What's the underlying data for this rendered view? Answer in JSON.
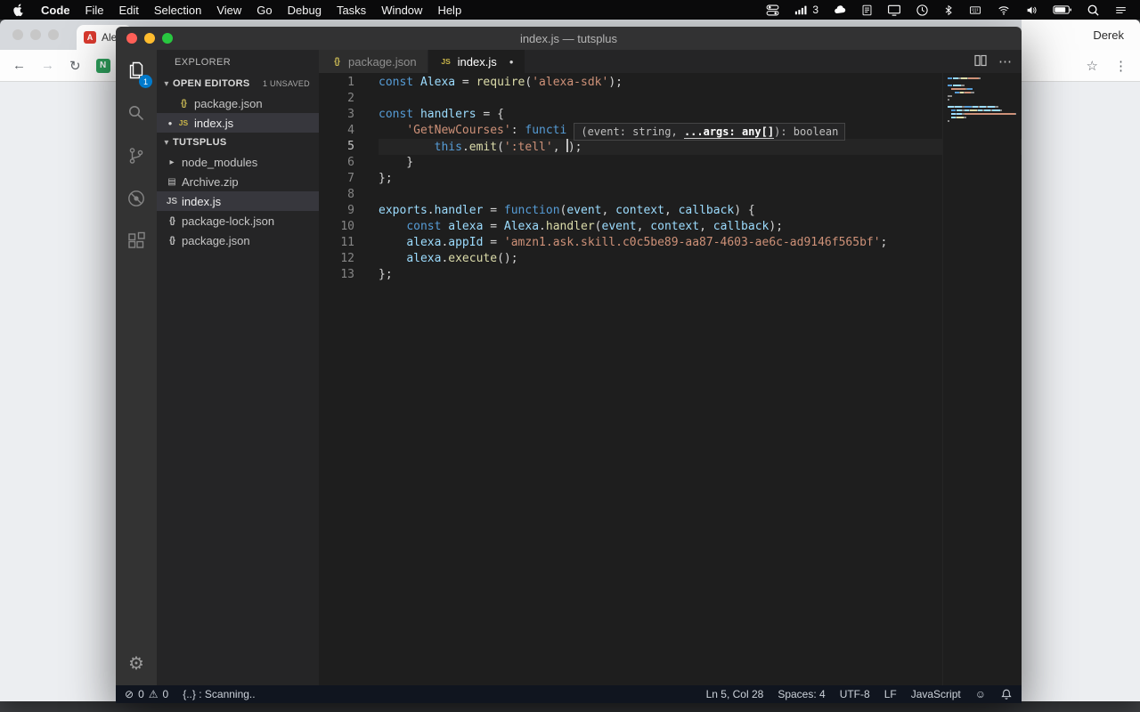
{
  "menubar": {
    "app_name": "Code",
    "items": [
      "File",
      "Edit",
      "Selection",
      "View",
      "Go",
      "Debug",
      "Tasks",
      "Window",
      "Help"
    ],
    "status": {
      "icons": [
        "control-center",
        "cellular",
        "cloud",
        "document",
        "display",
        "clock",
        "bluetooth",
        "keyboard",
        "wifi",
        "volume",
        "battery",
        "spotlight",
        "menu"
      ],
      "cellular_label": "3"
    }
  },
  "browser": {
    "tab_label": "Ale",
    "profile_name": "Derek",
    "site_badge": "N"
  },
  "vscode": {
    "title": "index.js — tutsplus",
    "activity_bar": {
      "items": [
        {
          "icon": "explorer",
          "badge": "1",
          "active": true
        },
        {
          "icon": "search",
          "active": false
        },
        {
          "icon": "source-control",
          "active": false
        },
        {
          "icon": "debug",
          "active": false
        },
        {
          "icon": "extensions",
          "active": false
        }
      ]
    },
    "sidebar": {
      "title": "EXPLORER",
      "open_editors_label": "OPEN EDITORS",
      "open_editors_badge": "1 UNSAVED",
      "open_editors": [
        {
          "icon": "json",
          "name": "package.json",
          "modified": false,
          "active": false
        },
        {
          "icon": "js",
          "name": "index.js",
          "modified": true,
          "active": true
        }
      ],
      "folder_label": "TUTSPLUS",
      "files": [
        {
          "icon": "folder",
          "name": "node_modules",
          "chevron": true,
          "selected": false
        },
        {
          "icon": "zip",
          "name": "Archive.zip",
          "chevron": false,
          "selected": false
        },
        {
          "icon": "js",
          "name": "index.js",
          "chevron": false,
          "selected": true
        },
        {
          "icon": "json",
          "name": "package-lock.json",
          "chevron": false,
          "selected": false
        },
        {
          "icon": "json",
          "name": "package.json",
          "chevron": false,
          "selected": false
        }
      ]
    },
    "tabs": [
      {
        "icon": "json",
        "label": "package.json",
        "active": false,
        "modified": false
      },
      {
        "icon": "js",
        "label": "index.js",
        "active": true,
        "modified": true
      }
    ],
    "editor": {
      "param_hint": {
        "pre": "(event: string, ",
        "active": "...args: any[]",
        "post": "): boolean"
      },
      "lines": [
        {
          "tokens": [
            [
              "kw",
              "const"
            ],
            [
              "pl",
              " "
            ],
            [
              "vr",
              "Alexa"
            ],
            [
              "pl",
              " = "
            ],
            [
              "fn",
              "require"
            ],
            [
              "pl",
              "("
            ],
            [
              "st",
              "'alexa-sdk'"
            ],
            [
              "pl",
              ");"
            ]
          ]
        },
        {
          "tokens": []
        },
        {
          "tokens": [
            [
              "kw",
              "const"
            ],
            [
              "pl",
              " "
            ],
            [
              "vr",
              "handlers"
            ],
            [
              "pl",
              " = {"
            ]
          ]
        },
        {
          "tokens": [
            [
              "pl",
              "    "
            ],
            [
              "st",
              "'GetNewCourses'"
            ],
            [
              "pl",
              ": "
            ],
            [
              "kw",
              "functi"
            ]
          ],
          "hint": true
        },
        {
          "tokens": [
            [
              "pl",
              "        "
            ],
            [
              "kw",
              "this"
            ],
            [
              "pl",
              "."
            ],
            [
              "fn",
              "emit"
            ],
            [
              "pl",
              "("
            ],
            [
              "st",
              "':tell'"
            ],
            [
              "pl",
              ", "
            ],
            [
              "cursor",
              ""
            ],
            [
              "pl",
              ");"
            ]
          ],
          "current": true
        },
        {
          "tokens": [
            [
              "pl",
              "    }"
            ]
          ]
        },
        {
          "tokens": [
            [
              "pl",
              "};"
            ]
          ]
        },
        {
          "tokens": []
        },
        {
          "tokens": [
            [
              "vr",
              "exports"
            ],
            [
              "pl",
              "."
            ],
            [
              "vr",
              "handler"
            ],
            [
              "pl",
              " = "
            ],
            [
              "kw",
              "function"
            ],
            [
              "pl",
              "("
            ],
            [
              "vr",
              "event"
            ],
            [
              "pl",
              ", "
            ],
            [
              "vr",
              "context"
            ],
            [
              "pl",
              ", "
            ],
            [
              "vr",
              "callback"
            ],
            [
              "pl",
              ") {"
            ]
          ]
        },
        {
          "tokens": [
            [
              "pl",
              "    "
            ],
            [
              "kw",
              "const"
            ],
            [
              "pl",
              " "
            ],
            [
              "vr",
              "alexa"
            ],
            [
              "pl",
              " = "
            ],
            [
              "vr",
              "Alexa"
            ],
            [
              "pl",
              "."
            ],
            [
              "fn",
              "handler"
            ],
            [
              "pl",
              "("
            ],
            [
              "vr",
              "event"
            ],
            [
              "pl",
              ", "
            ],
            [
              "vr",
              "context"
            ],
            [
              "pl",
              ", "
            ],
            [
              "vr",
              "callback"
            ],
            [
              "pl",
              ");"
            ]
          ]
        },
        {
          "tokens": [
            [
              "pl",
              "    "
            ],
            [
              "vr",
              "alexa"
            ],
            [
              "pl",
              "."
            ],
            [
              "vr",
              "appId"
            ],
            [
              "pl",
              " = "
            ],
            [
              "st",
              "'amzn1.ask.skill.c0c5be89-aa87-4603-ae6c-ad9146f565bf'"
            ],
            [
              "pl",
              ";"
            ]
          ]
        },
        {
          "tokens": [
            [
              "pl",
              "    "
            ],
            [
              "vr",
              "alexa"
            ],
            [
              "pl",
              "."
            ],
            [
              "fn",
              "execute"
            ],
            [
              "pl",
              "();"
            ]
          ]
        },
        {
          "tokens": [
            [
              "pl",
              "};"
            ]
          ]
        }
      ]
    },
    "status_bar": {
      "errors": "0",
      "warnings": "0",
      "message": "{..} : Scanning..",
      "line_col": "Ln 5, Col 28",
      "indent": "Spaces: 4",
      "encoding": "UTF-8",
      "eol": "LF",
      "language": "JavaScript"
    }
  },
  "colors": {
    "accent_blue": "#007acc",
    "keyword": "#569cd6",
    "variable": "#9cdcfe",
    "function": "#dcdcaa",
    "string": "#ce9178",
    "plain_text": "#d4d4d4",
    "editor_bg": "#1e1e1e",
    "sidebar_bg": "#252526",
    "activitybar_bg": "#333333"
  }
}
